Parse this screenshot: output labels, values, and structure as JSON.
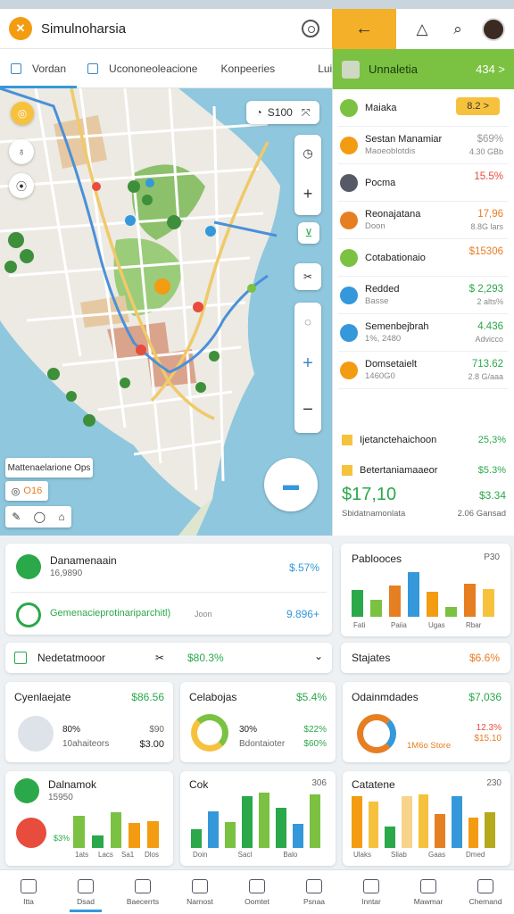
{
  "app": {
    "title": "Simulnoharsia",
    "logo_icon": "tools-icon"
  },
  "topbar": {
    "back_icon": "arrow-left-icon",
    "bell_icon": "bell-icon",
    "search_icon": "search-icon"
  },
  "tabs": [
    {
      "label": "Vordan",
      "active": true
    },
    {
      "label": "Ucononeoleacione",
      "active": false
    },
    {
      "label": "Konpeeries",
      "active": false
    },
    {
      "label": "Luids",
      "active": false
    }
  ],
  "map": {
    "scale_label": "S100",
    "legend_label": "Mattenaelarione Ops",
    "chip_label": "O16",
    "fab_icon": "layers-icon"
  },
  "right_panel": {
    "header": {
      "title": "Unnaletia",
      "value": "434 >"
    },
    "items": [
      {
        "title": "Maiaka",
        "sub": "",
        "value": "",
        "sub_value": "",
        "badge": "8.2 >",
        "color": "#7bc142",
        "value_color": "#333"
      },
      {
        "title": "Sestan Manamiar",
        "sub": "Maoeoblotdis",
        "value": "$69%",
        "sub_value": "4.30 GBb",
        "color": "#f39c12",
        "value_color": "#999"
      },
      {
        "title": "Pocma",
        "sub": "",
        "value": "15.5%",
        "sub_value": "",
        "color": "#555a66",
        "value_color": "#e74c3c"
      },
      {
        "title": "Reonajatana",
        "sub": "Doon",
        "value": "17,96",
        "sub_value": "8.8G lars",
        "color": "#e67e22",
        "value_color": "#e67e22"
      },
      {
        "title": "Cotabationaio",
        "sub": "",
        "value": "$15306",
        "sub_value": "",
        "color": "#7bc142",
        "value_color": "#e67e22"
      },
      {
        "title": "Redded",
        "sub": "Basse",
        "value": "$ 2,293",
        "sub_value": "2 alts%",
        "color": "#3498db",
        "value_color": "#2ba84a"
      },
      {
        "title": "Semenbejbrah",
        "sub": "1%, 2480",
        "value": "4.436",
        "sub_value": "Advicco",
        "color": "#3498db",
        "value_color": "#2ba84a"
      },
      {
        "title": "Domsetaielt",
        "sub": "1460G0",
        "value": "713.62",
        "sub_value": "2.8 G/aaa",
        "color": "#f39c12",
        "value_color": "#2ba84a"
      }
    ],
    "summary": {
      "title": "Ijetanctehaichoon",
      "title_value": "25,3%",
      "sub_title": "Betertaniamaaeor",
      "sub_value": "$5.3%",
      "big_value": "$17,10",
      "big_right": "$3.34",
      "foot_left": "Sbidatnamonlata",
      "foot_right": "2.06 Gansad"
    }
  },
  "cards": {
    "left_top": {
      "row1_title": "Danamenaain",
      "row1_sub": "16,9890",
      "row1_value": "$.57%",
      "row2_title": "Gemenacieprotinariparchitl)",
      "row2_sub": "Joon",
      "row2_value": "9.896+"
    },
    "right_top": {
      "title": "Pablooces",
      "value": "P30",
      "bars": [
        48,
        30,
        56,
        80,
        45,
        18,
        60,
        50
      ],
      "colors": [
        "#2ba84a",
        "#7bc142",
        "#e67e22",
        "#3498db",
        "#f39c12",
        "#7bc142",
        "#e67e22",
        "#f6c23e"
      ],
      "labels": [
        "Fati",
        "Paiia",
        "Ugas",
        "Rbar"
      ]
    },
    "filter_row": {
      "title": "Nedetatmooor",
      "value": "$80.3%",
      "right_title": "Stajates",
      "right_value": "$6.6%"
    },
    "row2": [
      {
        "title": "Cyenlaejate",
        "value": "$86.56",
        "line1": "80%",
        "line2": "10ahaiteors",
        "r1": "$90",
        "r2": "$3.00"
      },
      {
        "title": "Celabojas",
        "value": "$5.4%",
        "line1": "30%",
        "line2": "Bdontaioter",
        "r1": "$22%",
        "r2": "$60%"
      },
      {
        "title": "Odainmdades",
        "value": "$7,036",
        "line1": "",
        "line2": "",
        "r1": "12.3%",
        "r2": "$15.10",
        "r3": "1M6o Store"
      }
    ],
    "row3": [
      {
        "title": "Dalnamok",
        "sub": "15950",
        "pct": "$3%",
        "labels": [
          "1ats",
          "Lacs",
          "Sa1",
          "Dlos"
        ],
        "bars": [
          36,
          14,
          40,
          28,
          30
        ],
        "colors": [
          "#7bc142",
          "#2ba84a",
          "#7bc142",
          "#f39c12",
          "#f39c12"
        ]
      },
      {
        "title": "Cok",
        "value": "306",
        "labels": [
          "Doin",
          "Sacl",
          "Balo"
        ],
        "bars": [
          20,
          40,
          28,
          56,
          60,
          44,
          26,
          58
        ],
        "colors": [
          "#2ba84a",
          "#3498db",
          "#7bc142",
          "#2ba84a",
          "#7bc142",
          "#2ba84a",
          "#3498db",
          "#7bc142"
        ]
      },
      {
        "title": "Catatene",
        "value": "230",
        "labels": [
          "Ulaks",
          "Sliab",
          "Gaas",
          "Dmed"
        ],
        "bars": [
          58,
          52,
          24,
          58,
          60,
          38,
          58,
          34,
          40
        ],
        "colors": [
          "#f39c12",
          "#f6c23e",
          "#2ba84a",
          "#f6d58a",
          "#f6c23e",
          "#e67e22",
          "#3498db",
          "#f39c12",
          "#b5a91c"
        ]
      }
    ]
  },
  "bottom_nav": [
    {
      "label": "Itta",
      "icon": "home-icon",
      "active": false
    },
    {
      "label": "Dsad",
      "icon": "profile-icon",
      "active": true
    },
    {
      "label": "Baecerrts",
      "icon": "book-icon",
      "active": false
    },
    {
      "label": "Narnost",
      "icon": "calendar-icon",
      "active": false
    },
    {
      "label": "Oomtet",
      "icon": "target-icon",
      "active": false
    },
    {
      "label": "Psnaa",
      "icon": "gift-icon",
      "active": false
    },
    {
      "label": "Inntar",
      "icon": "printer-icon",
      "active": false
    },
    {
      "label": "Mawmar",
      "icon": "search-icon",
      "active": false
    },
    {
      "label": "Chemand",
      "icon": "people-icon",
      "active": false
    }
  ]
}
